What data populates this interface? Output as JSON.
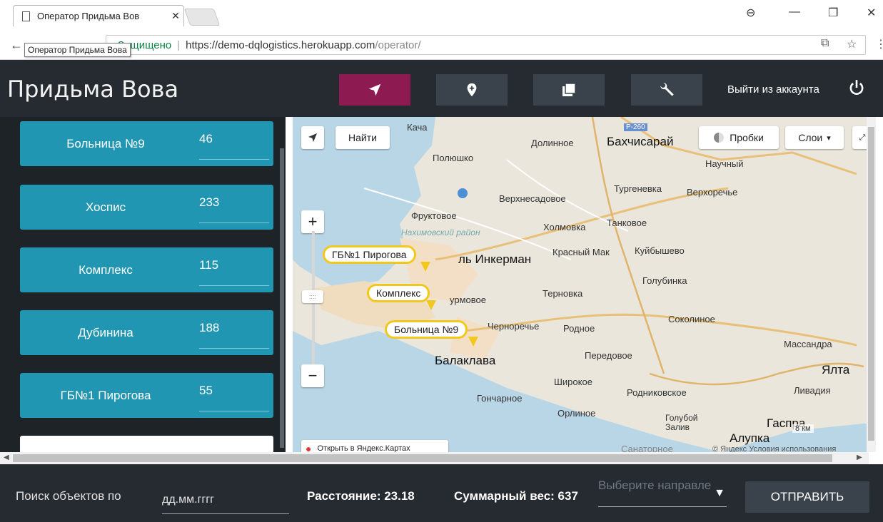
{
  "browser": {
    "tab_title": "Оператор Придьма Вов",
    "tooltip": "Оператор Придьма Вова",
    "secure_label": "Защищено",
    "url_host": "https://demo-dqlogistics.herokuapp.com",
    "url_path": "/operator/"
  },
  "header": {
    "title": "Придьма Вова",
    "logout_label": "Выйти из аккаунта",
    "active_color": "#8e1a52",
    "buttons": [
      "navigation-icon",
      "map-marker-icon",
      "library-icon",
      "wrench-icon"
    ]
  },
  "objects": [
    {
      "name": "Больница №9",
      "value": "46"
    },
    {
      "name": "Хоспис",
      "value": "233"
    },
    {
      "name": "Комплекс",
      "value": "115"
    },
    {
      "name": "Дубинина",
      "value": "188"
    },
    {
      "name": "ГБ№1 Пирогова",
      "value": "55"
    }
  ],
  "map": {
    "find_label": "Найти",
    "traffic_label": "Пробки",
    "layers_label": "Слои",
    "open_yandex": "Открыть в Яндекс.Картах",
    "scale_label": "8 км",
    "copyright": "© Яндекс Условия использования",
    "markers": [
      "ГБ№1 Пирогова",
      "Комплекс",
      "Больница №9"
    ],
    "road_label": "Р-260",
    "places": {
      "kacha": "Кача",
      "dolinnoe": "Долинное",
      "bakhchisaray": "Бахчисарай",
      "nauchny": "Научный",
      "poleshko": "Полюшко",
      "verkhnesadovoe": "Верхнесадовое",
      "turgenevka": "Тургеневка",
      "verkhorechye": "Верхоречье",
      "fruktovoe": "Фруктовое",
      "nakhimovsky": "Нахимовский район",
      "kholmovka": "Холмовка",
      "tankovoe": "Танковое",
      "inkerman": "ль Инкерман",
      "krasny_mak": "Красный Мак",
      "kuibyshevo": "Куйбышево",
      "golubinka": "Голубинка",
      "ternovka": "Терновка",
      "urmovoe": "урмовое",
      "sokolinoe": "Соколиное",
      "chernorechye": "Черноречье",
      "rodnoe": "Родное",
      "balaklava": "Балаклава",
      "peredovoe": "Передовое",
      "massandra": "Массандра",
      "yalta": "Ялта",
      "livadiya": "Ливадия",
      "shirokoe": "Широкое",
      "rodnikovskoe": "Родниковское",
      "goncharnoe": "Гончарное",
      "orlinoe": "Орлиное",
      "goluboy_zaliv": "Голубой Залив",
      "gaspra": "Гаспра",
      "alupka": "Алупка",
      "sanatornoe": "Санаторное"
    }
  },
  "bottom": {
    "search_label": "Поиск объектов по",
    "date_placeholder": "дд.мм.гггг",
    "distance": "Расстояние: 23.18",
    "weight": "Суммарный вес: 637",
    "direction_placeholder": "Выберите направле",
    "send_label": "ОТПРАВИТЬ"
  }
}
